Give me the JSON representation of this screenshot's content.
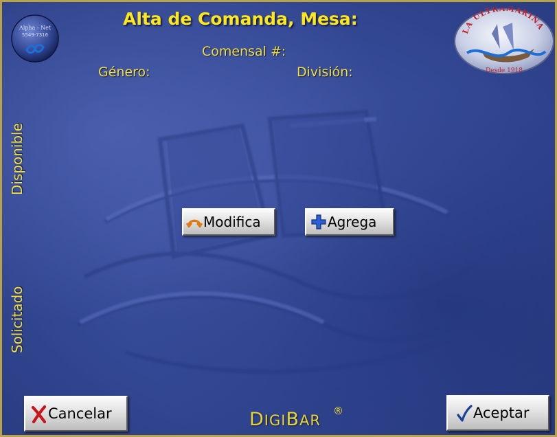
{
  "header": {
    "title": "Alta de Comanda, Mesa:",
    "comensal_label": "Comensal #:",
    "genero_label": "Género:",
    "division_label": "División:"
  },
  "side_labels": {
    "disponible": "Disponible",
    "solicitado": "Solicitado"
  },
  "actions": {
    "modifica_label": "Modifica",
    "agrega_label": "Agrega",
    "cancelar_label": "Cancelar",
    "aceptar_label": "Aceptar"
  },
  "logos": {
    "left_line1": "Alpha - Net",
    "left_line2": "5549-7316",
    "right_top": "LA ULTRAMARINA",
    "right_bottom": "Desde 1918"
  },
  "brand": {
    "first": "D",
    "first_small": "IGI",
    "second": "B",
    "second_small": "AR",
    "reg": "®"
  },
  "icons": {
    "modifica": "undo-arc-icon",
    "agrega": "plus-icon",
    "cancelar": "x-mark-icon",
    "aceptar": "check-mark-icon"
  },
  "colors": {
    "background": "#3a4f9c",
    "title": "#ffe81a",
    "label": "#f2df3a",
    "border": "#b8a24a",
    "cancel_icon": "#c8141c",
    "add_icon": "#2a5fd8",
    "modify_icon": "#e07a10",
    "accept_icon": "#1c3f9a"
  }
}
